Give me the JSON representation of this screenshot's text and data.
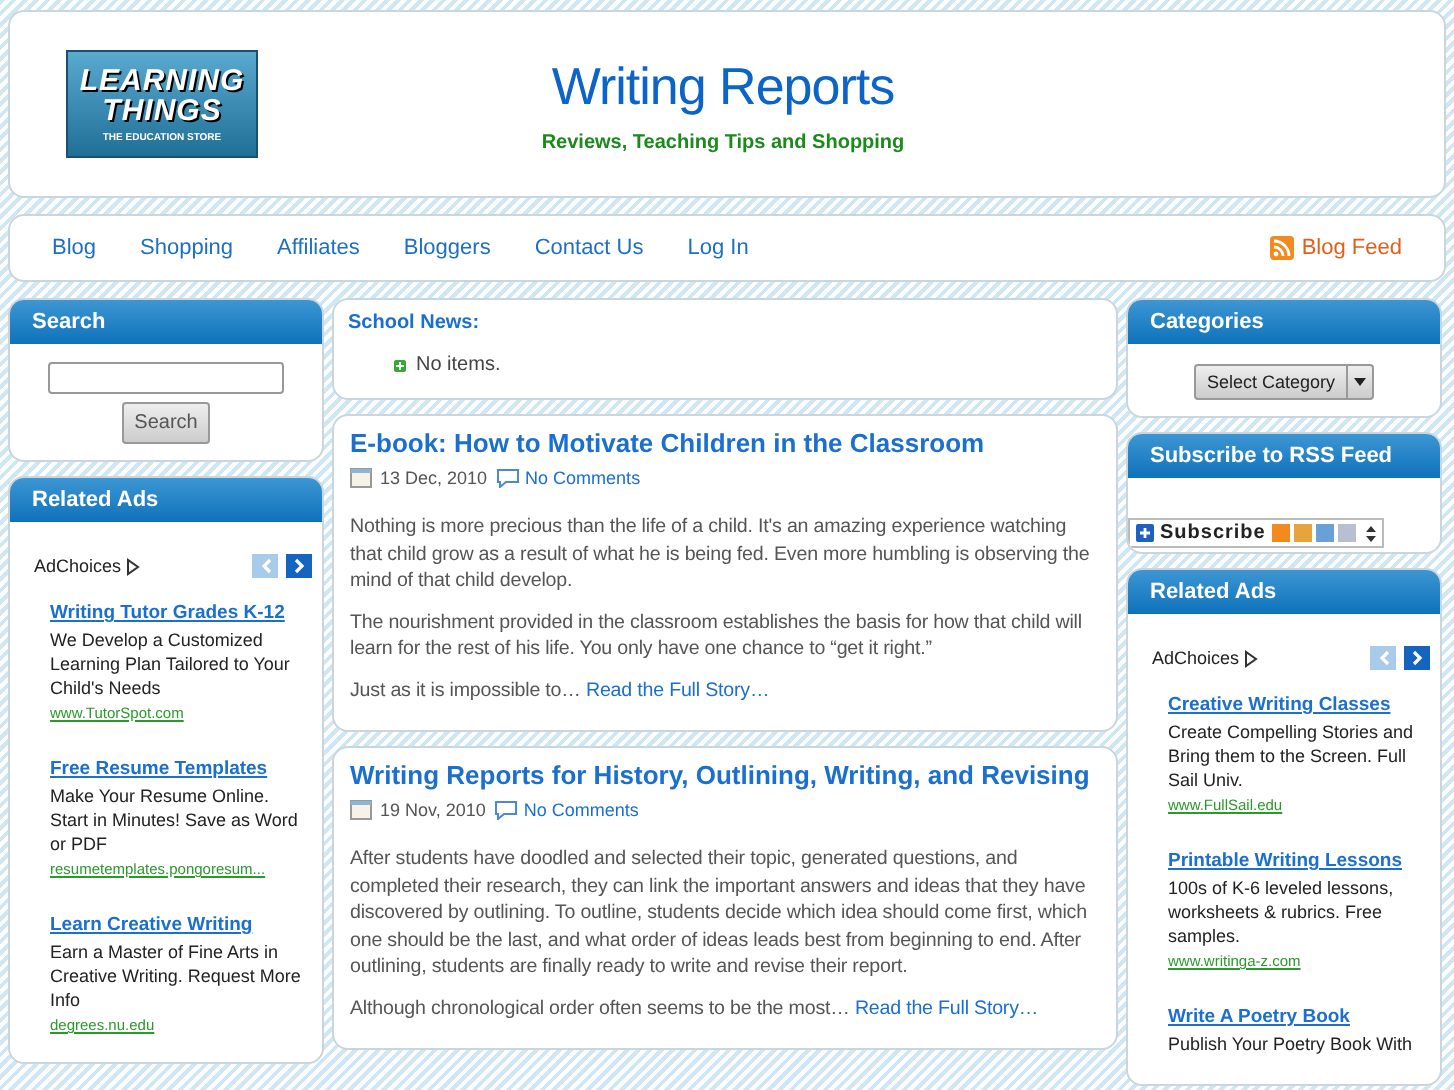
{
  "header": {
    "logo": {
      "line_1": "LEARNING",
      "line_2": "THINGS",
      "tagline": "THE EDUCATION STORE"
    },
    "title": "Writing Reports",
    "subtitle": "Reviews, Teaching Tips and Shopping"
  },
  "nav": {
    "items": [
      {
        "label": "Blog"
      },
      {
        "label": "Shopping"
      },
      {
        "label": "Affiliates"
      },
      {
        "label": "Bloggers"
      },
      {
        "label": "Contact Us"
      },
      {
        "label": "Log In"
      }
    ],
    "feed": "Blog Feed"
  },
  "left": {
    "search": {
      "title": "Search",
      "button": "Search"
    },
    "related_ads": {
      "title": "Related Ads",
      "adchoices": "AdChoices",
      "ads": [
        {
          "title": "Writing Tutor Grades K-12",
          "text": "We Develop a Customized Learning Plan Tailored to Your Child's Needs",
          "url": "www.TutorSpot.com"
        },
        {
          "title": "Free Resume Templates",
          "text": "Make Your Resume Online. Start in Minutes! Save as Word or PDF",
          "url": "resumetemplates.pongoresum..."
        },
        {
          "title": "Learn Creative Writing",
          "text": "Earn a Master of Fine Arts in Creative Writing. Request More Info",
          "url": "degrees.nu.edu"
        }
      ]
    }
  },
  "center": {
    "school_news": {
      "title": "School News:",
      "items": [
        "No items."
      ]
    },
    "posts": [
      {
        "title": "E-book: How to Motivate Children in the Classroom",
        "date": "13 Dec, 2010",
        "comments": "No Comments",
        "paragraphs": [
          "Nothing is more precious than the life of a child. It's an amazing experience watching that child grow as a result of what he is being fed. Even more humbling is observing the mind of that child develop.",
          "The nourishment provided in the classroom establishes the basis for how that child will learn for the rest of his life. You only have one chance to “get it right.”"
        ],
        "excerpt": "Just as it is impossible to…",
        "more": "Read the Full Story…"
      },
      {
        "title": "Writing Reports for History, Outlining, Writing, and Revising",
        "date": "19 Nov, 2010",
        "comments": "No Comments",
        "paragraphs": [
          "After students have doodled and selected their topic, generated questions, and completed their research, they can link the important answers and ideas that they have discovered by outlining. To outline, students decide which idea should come first, which one should be the last, and what order of ideas leads best from beginning to end.  After outlining, students are finally ready to write and revise their report."
        ],
        "excerpt": "Although chronological order often seems to be the most…",
        "more": "Read the Full Story…"
      }
    ]
  },
  "right": {
    "categories": {
      "title": "Categories",
      "select": "Select Category"
    },
    "rss": {
      "title": "Subscribe to RSS Feed",
      "button": "Subscribe"
    },
    "related_ads": {
      "title": "Related Ads",
      "adchoices": "AdChoices",
      "ads": [
        {
          "title": "Creative Writing Classes",
          "text": "Create Compelling Stories and Bring them to the Screen. Full Sail Univ.",
          "url": "www.FullSail.edu"
        },
        {
          "title": "Printable Writing Lessons",
          "text": "100s of K-6 leveled lessons, worksheets & rubrics. Free samples.",
          "url": "www.writinga-z.com"
        },
        {
          "title": "Write A Poetry Book",
          "text": "Publish Your Poetry Book With"
        }
      ]
    }
  }
}
